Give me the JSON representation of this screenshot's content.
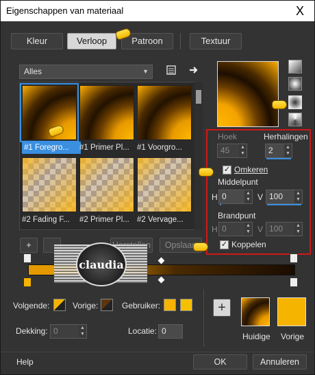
{
  "window": {
    "title": "Eigenschappen van materiaal",
    "close_glyph": "X"
  },
  "tabs": [
    {
      "label": "Kleur",
      "active": false
    },
    {
      "label": "Verloop",
      "active": true
    },
    {
      "label": "Patroon",
      "active": false
    },
    {
      "label": "Textuur",
      "active": false
    }
  ],
  "category_select": {
    "value": "Alles"
  },
  "gallery": {
    "items": [
      {
        "caption": "#1 Foregro...",
        "selected": true,
        "style": "gradient"
      },
      {
        "caption": "#1 Primer Pl...",
        "selected": false,
        "style": "gradient"
      },
      {
        "caption": "#1 Voorgro...",
        "selected": false,
        "style": "gradient"
      },
      {
        "caption": "#2 Fading F...",
        "selected": false,
        "style": "fading"
      },
      {
        "caption": "#2 Primer Pl...",
        "selected": false,
        "style": "fading"
      },
      {
        "caption": "#2 Vervage...",
        "selected": false,
        "style": "fading"
      }
    ]
  },
  "gallery_buttons": {
    "add": "+",
    "reset": "Herstellen",
    "save": "Opslaan"
  },
  "settings": {
    "angle_label": "Hoek",
    "angle_value": "45",
    "repeats_label": "Herhalingen",
    "repeats_value": "2",
    "invert_label": "Omkeren",
    "invert_checked": true,
    "center_label": "Middelpunt",
    "center_h_label": "H",
    "center_h_value": "0",
    "center_v_label": "V",
    "center_v_value": "100",
    "focal_label": "Brandpunt",
    "focal_h_label": "H",
    "focal_h_value": "0",
    "focal_v_label": "V",
    "focal_v_value": "100",
    "link_label": "Koppelen",
    "link_checked": true
  },
  "stops": {
    "foreground_label": "Volgende:",
    "background_label": "Vorige:",
    "user_label": "Gebruiker:",
    "opacity_label": "Dekking:",
    "opacity_value": "0",
    "location_label": "Locatie:",
    "location_value": "0"
  },
  "compare": {
    "current_label": "Huidige",
    "previous_label": "Vorige",
    "add_glyph": "+"
  },
  "footer": {
    "help": "Help",
    "ok": "OK",
    "cancel": "Annuleren"
  },
  "watermark": {
    "text": "claudia"
  },
  "colors": {
    "accent": "#3a8fe0",
    "highlight_border": "#d01818",
    "gold": "#f5b400",
    "dark_brown": "#1a0c00"
  }
}
